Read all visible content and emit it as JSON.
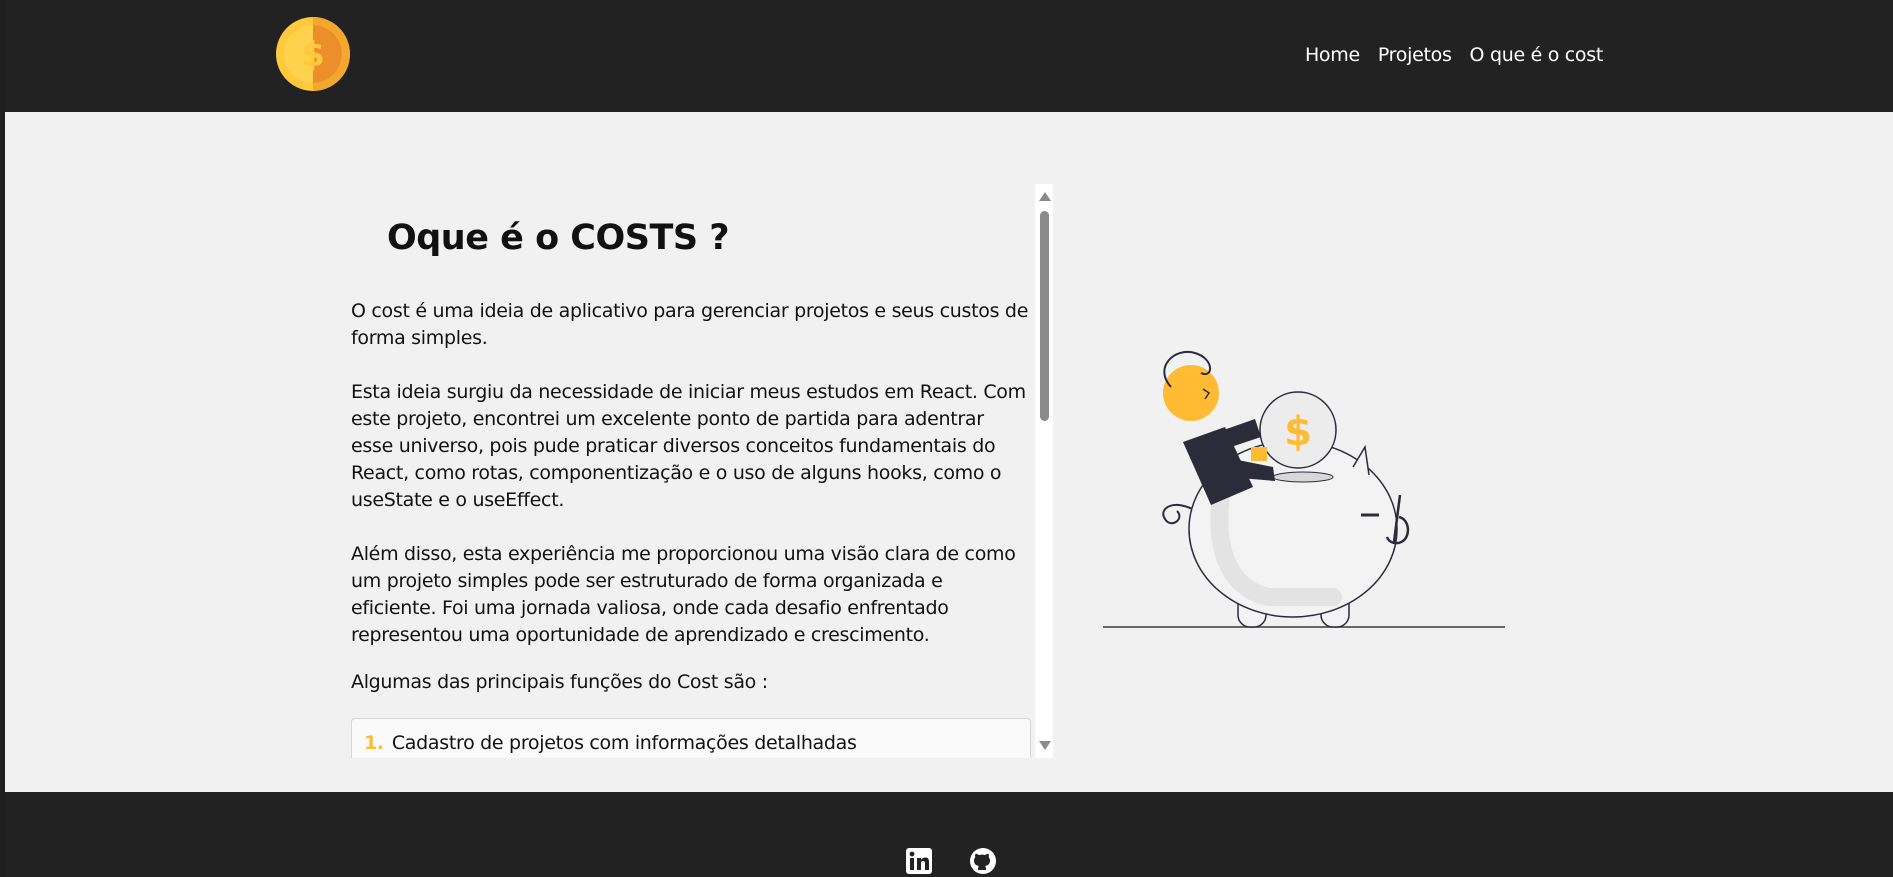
{
  "nav": {
    "links": [
      "Home",
      "Projetos",
      "O que é o cost"
    ]
  },
  "content": {
    "title": "Oque é o COSTS ?",
    "paragraphs": [
      "O cost é uma ideia de aplicativo para gerenciar projetos e seus custos de forma simples.",
      "Esta ideia surgiu da necessidade de iniciar meus estudos em React. Com este projeto, encontrei um excelente ponto de partida para adentrar esse universo, pois pude praticar diversos conceitos fundamentais do React, como rotas, componentização e o uso de alguns hooks, como o useState e o useEffect.",
      "Além disso, esta experiência me proporcionou uma visão clara de como um projeto simples pode ser estruturado de forma organizada e eficiente. Foi uma jornada valiosa, onde cada desafio enfrentado representou uma oportunidade de aprendizado e crescimento.",
      "Algumas das principais funções do Cost são :"
    ],
    "features": [
      {
        "num": "1.",
        "text": "Cadastro de projetos com informações detalhadas"
      }
    ]
  },
  "colors": {
    "navbar": "#222222",
    "background": "#f1f1f1",
    "accent": "#ffbb33",
    "text": "#111111"
  },
  "icons": {
    "logo": "dollar-coin-icon",
    "footer": [
      "linkedin-icon",
      "github-icon"
    ]
  }
}
